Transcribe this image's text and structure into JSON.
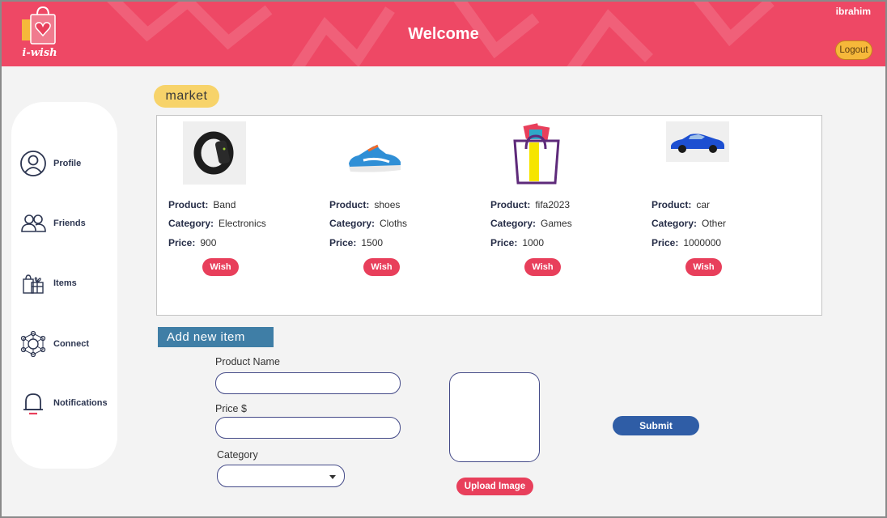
{
  "header": {
    "logo_text": "i-wish",
    "title": "Welcome",
    "username": "ibrahim",
    "logout_label": "Logout",
    "accent_color": "#ee4865"
  },
  "sidebar": {
    "items": [
      {
        "label": "Profile",
        "icon": "user-circle-icon"
      },
      {
        "label": "Friends",
        "icon": "users-icon"
      },
      {
        "label": "Items",
        "icon": "gift-bags-icon"
      },
      {
        "label": "Connect",
        "icon": "network-icon"
      },
      {
        "label": "Notifications",
        "icon": "bell-icon"
      }
    ]
  },
  "market": {
    "heading": "market",
    "field_labels": {
      "product": "Product:",
      "category": "Category:",
      "price": "Price:"
    },
    "products": [
      {
        "name": "Band",
        "category": "Electronics",
        "price": "900",
        "image": "smart-band-image",
        "wish_label": "Wish"
      },
      {
        "name": "shoes",
        "category": "Cloths",
        "price": "1500",
        "image": "sneaker-image",
        "wish_label": "Wish"
      },
      {
        "name": "fifa2023",
        "category": "Games",
        "price": "1000",
        "image": "shopping-bag-image",
        "wish_label": "Wish"
      },
      {
        "name": "car",
        "category": "Other",
        "price": "1000000",
        "image": "car-image",
        "wish_label": "Wish"
      }
    ]
  },
  "add_item": {
    "heading": "Add new item",
    "product_name_label": "Product Name",
    "product_name_value": "",
    "price_label": "Price $",
    "price_value": "",
    "category_label": "Category",
    "category_value": "",
    "upload_label": "Upload Image",
    "submit_label": "Submit"
  },
  "colors": {
    "header": "#ee4865",
    "market_tag": "#f7d36a",
    "add_tag": "#3f7ea6",
    "wish_button": "#e83f5b",
    "submit_button": "#2f5da6",
    "logout_button": "#f6b83a"
  }
}
